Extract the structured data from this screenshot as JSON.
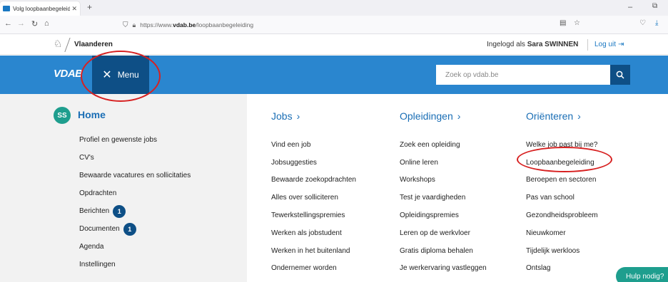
{
  "browser": {
    "tab_title": "Volg loopbaanbegeleiding met",
    "url_prefix": "https://www.",
    "url_domain": "vdab.be",
    "url_path": "/loopbaanbegeleiding"
  },
  "top_bar": {
    "brand": "Vlaanderen",
    "logged_in_prefix": "Ingelogd als",
    "user_name": "Sara SWINNEN",
    "logout_label": "Log uit"
  },
  "header": {
    "logo": "VDAB",
    "menu_label": "Menu",
    "search_placeholder": "Zoek op vdab.be"
  },
  "left_menu": {
    "avatar_initials": "SS",
    "home_label": "Home",
    "items": [
      {
        "label": "Profiel en gewenste jobs",
        "badge": null
      },
      {
        "label": "CV's",
        "badge": null
      },
      {
        "label": "Bewaarde vacatures en sollicitaties",
        "badge": null
      },
      {
        "label": "Opdrachten",
        "badge": null
      },
      {
        "label": "Berichten",
        "badge": "1"
      },
      {
        "label": "Documenten",
        "badge": "1"
      },
      {
        "label": "Agenda",
        "badge": null
      },
      {
        "label": "Instellingen",
        "badge": null
      }
    ]
  },
  "columns": [
    {
      "heading": "Jobs",
      "items": [
        "Vind een job",
        "Jobsuggesties",
        "Bewaarde zoekopdrachten",
        "Alles over solliciteren",
        "Tewerkstellingspremies",
        "Werken als jobstudent",
        "Werken in het buitenland",
        "Ondernemer worden"
      ]
    },
    {
      "heading": "Opleidingen",
      "items": [
        "Zoek een opleiding",
        "Online leren",
        "Workshops",
        "Test je vaardigheden",
        "Opleidingspremies",
        "Leren op de werkvloer",
        "Gratis diploma behalen",
        "Je werkervaring vastleggen"
      ]
    },
    {
      "heading": "Oriënteren",
      "items": [
        "Welke job past bij me?",
        "Loopbaanbegeleiding",
        "Beroepen en sectoren",
        "Pas van school",
        "Gezondheidsprobleem",
        "Nieuwkomer",
        "Tijdelijk werkloos",
        "Ontslag"
      ]
    }
  ],
  "help_label": "Hulp nodig?",
  "colors": {
    "header_blue": "#2a86cf",
    "dark_blue": "#0e4f86",
    "link_blue": "#1a6eb5",
    "teal": "#1e9e8e",
    "annotation_red": "#d72020"
  }
}
